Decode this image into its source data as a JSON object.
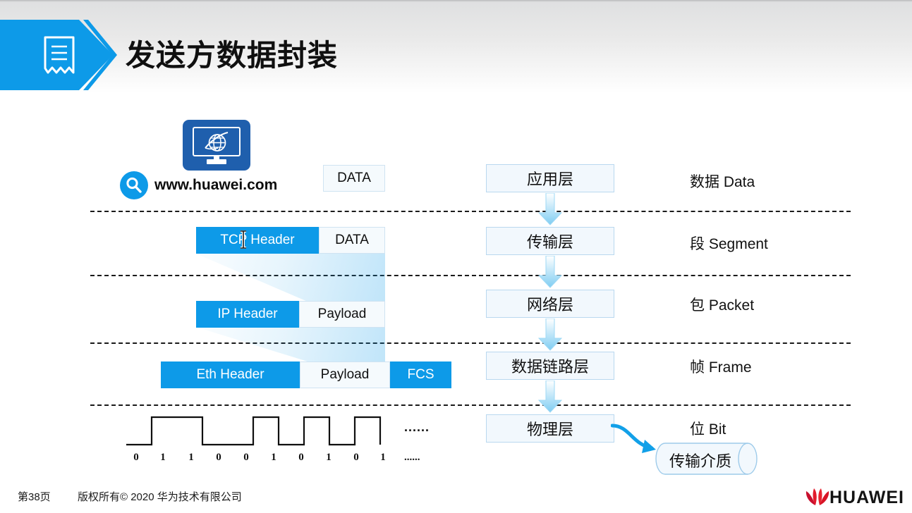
{
  "header": {
    "title": "发送方数据封装",
    "icon": "document-ribbon-icon"
  },
  "device": {
    "icon": "monitor-globe-icon",
    "search_icon": "magnifier-icon",
    "url": "www.huawei.com"
  },
  "packets": [
    {
      "row": "application",
      "cells": [
        {
          "label": "DATA",
          "kind": "payload"
        }
      ]
    },
    {
      "row": "transport",
      "cells": [
        {
          "label": "TCP Header",
          "kind": "header"
        },
        {
          "label": "DATA",
          "kind": "payload"
        }
      ]
    },
    {
      "row": "network",
      "cells": [
        {
          "label": "IP Header",
          "kind": "header"
        },
        {
          "label": "Payload",
          "kind": "payload"
        }
      ]
    },
    {
      "row": "datalink",
      "cells": [
        {
          "label": "Eth Header",
          "kind": "header"
        },
        {
          "label": "Payload",
          "kind": "payload"
        },
        {
          "label": "FCS",
          "kind": "header"
        }
      ]
    }
  ],
  "layers": [
    {
      "name": "应用层"
    },
    {
      "name": "传输层"
    },
    {
      "name": "网络层"
    },
    {
      "name": "数据链路层"
    },
    {
      "name": "物理层"
    }
  ],
  "pdu_labels": [
    "数据 Data",
    "段 Segment",
    "包 Packet",
    "帧 Frame",
    "位 Bit"
  ],
  "medium": {
    "label": "传输介质",
    "arrow_icon": "curved-arrow-icon"
  },
  "bitstream": {
    "bits": [
      "0",
      "1",
      "1",
      "0",
      "0",
      "1",
      "0",
      "1",
      "0",
      "1"
    ],
    "ellipsis_top": "......",
    "ellipsis_bottom": "......"
  },
  "footer": {
    "page": "第38页",
    "copyright": "版权所有© 2020 华为技术有限公司",
    "brand": "HUAWEI",
    "brand_icon": "huawei-flower-logo"
  },
  "cursor": {
    "type": "i-beam-cursor"
  },
  "colors": {
    "accent": "#0d9ae8",
    "device": "#1f5fad",
    "box_fill": "#f2f8fd",
    "box_border": "#b9d8ef",
    "brand_red": "#d61f26"
  }
}
